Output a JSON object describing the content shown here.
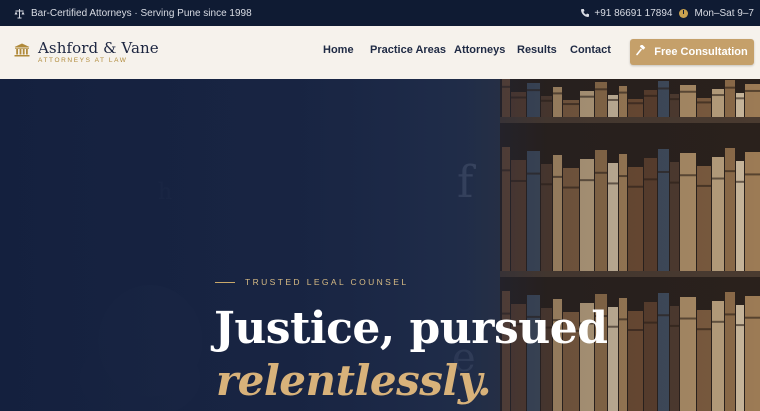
{
  "topbar": {
    "badge_icon": "scales-icon",
    "certification": "Bar-Certified Attorneys · Serving Pune since 1998",
    "phone_icon": "phone-icon",
    "phone": "+91 86691 17894",
    "clock_icon": "clock-icon",
    "hours": "Mon–Sat 9–7"
  },
  "header": {
    "logo_icon": "courthouse-icon",
    "brand": "Ashford & Vane",
    "tagline": "ATTORNEYS AT LAW",
    "nav": [
      {
        "label": "Home"
      },
      {
        "label": "Practice Areas"
      },
      {
        "label": "Attorneys"
      },
      {
        "label": "Results"
      },
      {
        "label": "Contact"
      }
    ],
    "cta": {
      "label": "Free Consultation",
      "icon": "gavel-icon"
    }
  },
  "hero": {
    "eyebrow": "TRUSTED LEGAL COUNSEL",
    "headline_line1": "Justice, pursued",
    "headline_line2": "relentlessly."
  },
  "colors": {
    "navy": "#0f1b33",
    "cream": "#f6f2ec",
    "gold": "#c5a06a",
    "gold_text": "#d8b27a"
  }
}
